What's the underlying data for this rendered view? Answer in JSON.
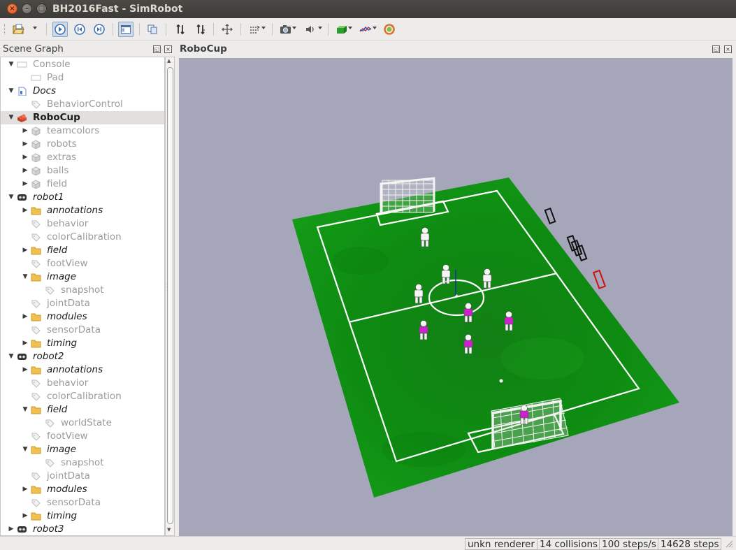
{
  "window": {
    "title": "BH2016Fast - SimRobot",
    "close_glyph": "×",
    "minimize_glyph": "–",
    "maximize_glyph": "□"
  },
  "toolbar": {
    "icons": [
      "open-file-icon",
      "dropdown-arrow-icon",
      "play-icon",
      "step-back-icon",
      "step-forward-icon",
      "scene-graph-toggle-icon",
      "copy-icon",
      "drag-and-drop-plane-icon",
      "drag-and-drop-reverse-icon",
      "move-icon",
      "drag-mode-icon",
      "camera-icon",
      "sound-icon",
      "render-mode-icon",
      "plot-icon",
      "reset-camera-icon"
    ]
  },
  "scene_graph": {
    "title": "Scene Graph",
    "float_glyph": "◱",
    "close_glyph": "×",
    "rows": [
      {
        "label": "Console",
        "arrow": "▼",
        "icon": "console-icon",
        "style": "grey",
        "depth": 0
      },
      {
        "label": "Pad",
        "arrow": "",
        "icon": "console-icon",
        "style": "grey",
        "depth": 1
      },
      {
        "label": "Docs",
        "arrow": "▼",
        "icon": "document-icon",
        "style": "dark-italic",
        "depth": 0
      },
      {
        "label": "BehaviorControl",
        "arrow": "",
        "icon": "tag-icon",
        "style": "grey",
        "depth": 1
      },
      {
        "label": "RoboCup",
        "arrow": "▼",
        "icon": "scene-icon",
        "style": "dark-bold",
        "depth": 0,
        "selected": true
      },
      {
        "label": "teamcolors",
        "arrow": "▶",
        "icon": "cube-icon",
        "style": "grey",
        "depth": 1
      },
      {
        "label": "robots",
        "arrow": "▶",
        "icon": "cube-icon",
        "style": "grey",
        "depth": 1
      },
      {
        "label": "extras",
        "arrow": "▶",
        "icon": "cube-icon",
        "style": "grey",
        "depth": 1
      },
      {
        "label": "balls",
        "arrow": "▶",
        "icon": "cube-icon",
        "style": "grey",
        "depth": 1
      },
      {
        "label": "field",
        "arrow": "▶",
        "icon": "cube-icon",
        "style": "grey",
        "depth": 1
      },
      {
        "label": "robot1",
        "arrow": "▼",
        "icon": "robot-icon",
        "style": "dark-italic",
        "depth": 0
      },
      {
        "label": "annotations",
        "arrow": "▶",
        "icon": "folder-icon",
        "style": "dark-italic",
        "depth": 1
      },
      {
        "label": "behavior",
        "arrow": "",
        "icon": "tag-icon",
        "style": "grey",
        "depth": 1
      },
      {
        "label": "colorCalibration",
        "arrow": "",
        "icon": "tag-icon",
        "style": "grey",
        "depth": 1
      },
      {
        "label": "field",
        "arrow": "▶",
        "icon": "folder-icon",
        "style": "dark-italic",
        "depth": 1
      },
      {
        "label": "footView",
        "arrow": "",
        "icon": "tag-icon",
        "style": "grey",
        "depth": 1
      },
      {
        "label": "image",
        "arrow": "▼",
        "icon": "folder-icon",
        "style": "dark-italic",
        "depth": 1
      },
      {
        "label": "snapshot",
        "arrow": "",
        "icon": "tag-icon",
        "style": "grey",
        "depth": 2
      },
      {
        "label": "jointData",
        "arrow": "",
        "icon": "tag-icon",
        "style": "grey",
        "depth": 1
      },
      {
        "label": "modules",
        "arrow": "▶",
        "icon": "folder-icon",
        "style": "dark-italic",
        "depth": 1
      },
      {
        "label": "sensorData",
        "arrow": "",
        "icon": "tag-icon",
        "style": "grey",
        "depth": 1
      },
      {
        "label": "timing",
        "arrow": "▶",
        "icon": "folder-icon",
        "style": "dark-italic",
        "depth": 1
      },
      {
        "label": "robot2",
        "arrow": "▼",
        "icon": "robot-icon",
        "style": "dark-italic",
        "depth": 0
      },
      {
        "label": "annotations",
        "arrow": "▶",
        "icon": "folder-icon",
        "style": "dark-italic",
        "depth": 1
      },
      {
        "label": "behavior",
        "arrow": "",
        "icon": "tag-icon",
        "style": "grey",
        "depth": 1
      },
      {
        "label": "colorCalibration",
        "arrow": "",
        "icon": "tag-icon",
        "style": "grey",
        "depth": 1
      },
      {
        "label": "field",
        "arrow": "▼",
        "icon": "folder-icon",
        "style": "dark-italic",
        "depth": 1
      },
      {
        "label": "worldState",
        "arrow": "",
        "icon": "tag-icon",
        "style": "grey",
        "depth": 2
      },
      {
        "label": "footView",
        "arrow": "",
        "icon": "tag-icon",
        "style": "grey",
        "depth": 1
      },
      {
        "label": "image",
        "arrow": "▼",
        "icon": "folder-icon",
        "style": "dark-italic",
        "depth": 1
      },
      {
        "label": "snapshot",
        "arrow": "",
        "icon": "tag-icon",
        "style": "grey",
        "depth": 2
      },
      {
        "label": "jointData",
        "arrow": "",
        "icon": "tag-icon",
        "style": "grey",
        "depth": 1
      },
      {
        "label": "modules",
        "arrow": "▶",
        "icon": "folder-icon",
        "style": "dark-italic",
        "depth": 1
      },
      {
        "label": "sensorData",
        "arrow": "",
        "icon": "tag-icon",
        "style": "grey",
        "depth": 1
      },
      {
        "label": "timing",
        "arrow": "▶",
        "icon": "folder-icon",
        "style": "dark-italic",
        "depth": 1
      },
      {
        "label": "robot3",
        "arrow": "▶",
        "icon": "robot-icon",
        "style": "dark-italic",
        "depth": 0
      }
    ]
  },
  "robocup_view": {
    "title": "RoboCup",
    "float_glyph": "◱",
    "close_glyph": "×",
    "colors": {
      "background": "#a5a6ba",
      "field_green": "#0f8f12",
      "field_lines": "#ffffff",
      "team_blue_player": "#ffffff",
      "team_red_player": "#cc22cc",
      "goal_marker_red": "#d01010"
    }
  },
  "status": {
    "renderer": "unkn renderer",
    "collisions": "14 collisions",
    "steps_rate": "100 steps/s",
    "steps_total": "14628 steps"
  }
}
